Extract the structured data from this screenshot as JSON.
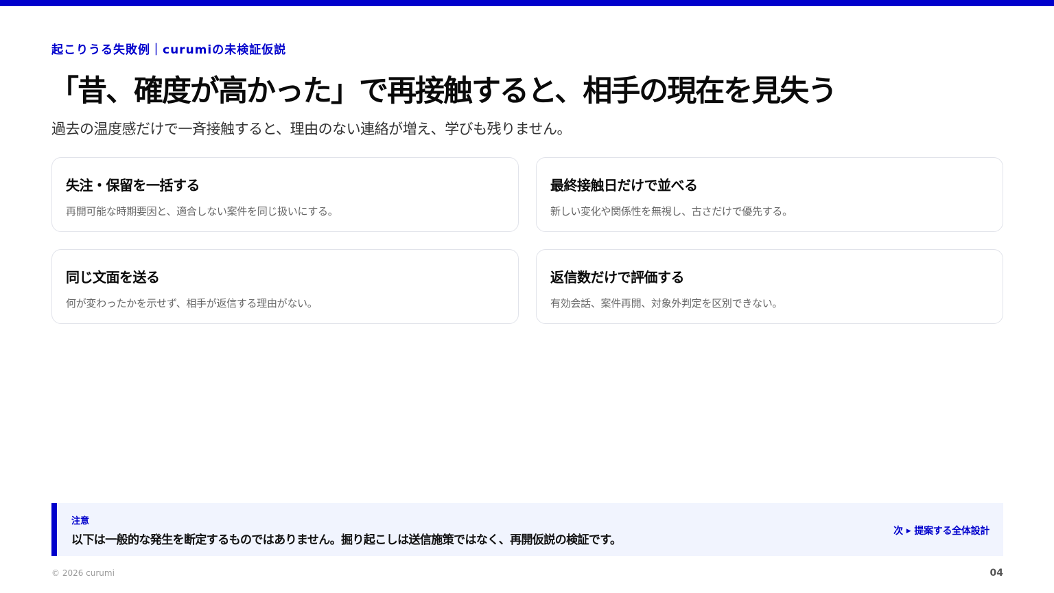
{
  "slide": {
    "eyebrow": "起こりうる失敗例｜curumiの未検証仮説",
    "title": "「昔、確度が高かった」で再接触すると、相手の現在を見失う",
    "subtitle": "過去の温度感だけで一斉接触すると、理由のない連絡が増え、学びも残りません。"
  },
  "cards": [
    {
      "title": "失注・保留を一括する",
      "desc": "再開可能な時期要因と、適合しない案件を同じ扱いにする。"
    },
    {
      "title": "最終接触日だけで並べる",
      "desc": "新しい変化や関係性を無視し、古さだけで優先する。"
    },
    {
      "title": "同じ文面を送る",
      "desc": "何が変わったかを示せず、相手が返信する理由がない。"
    },
    {
      "title": "返信数だけで評価する",
      "desc": "有効会話、案件再開、対象外判定を区別できない。"
    }
  ],
  "note": {
    "label": "注意",
    "text": "以下は一般的な発生を断定するものではありません。掘り起こしは送信施策ではなく、再開仮説の検証です。",
    "next_prefix": "次",
    "next_arrow": "▶",
    "next_label": "提案する全体設計"
  },
  "footer": {
    "copyright": "© 2026 curumi",
    "page_number": "04"
  },
  "colors": {
    "accent": "#0000cc",
    "note_bg": "#f1f4fe",
    "card_border": "#e1e3ea"
  }
}
